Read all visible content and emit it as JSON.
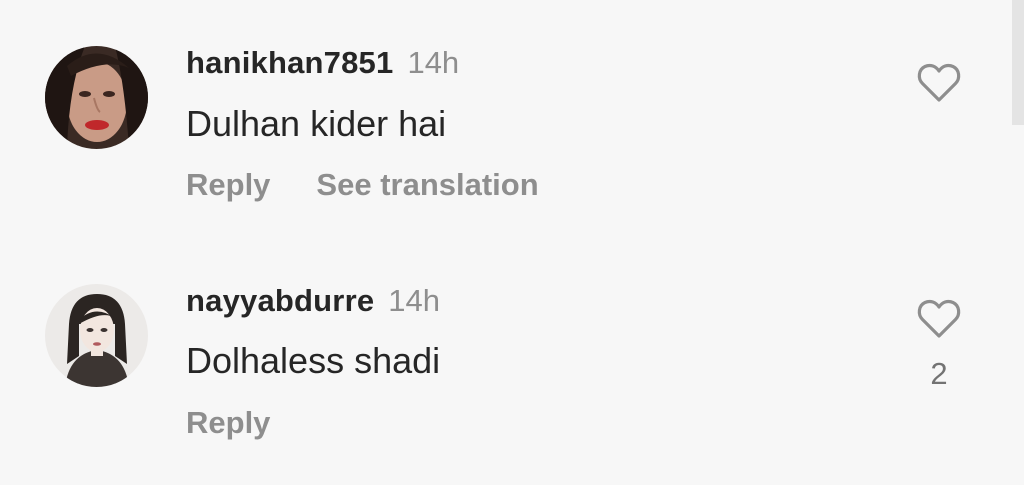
{
  "comments": [
    {
      "username": "hanikhan7851",
      "time": "14h",
      "text": "Dulhan kider hai",
      "reply_label": "Reply",
      "translate_label": "See translation",
      "like_count": ""
    },
    {
      "username": "nayyabdurre",
      "time": "14h",
      "text": "Dolhaless shadi",
      "reply_label": "Reply",
      "like_count": "2"
    }
  ],
  "icons": {
    "like": "heart-outline-icon"
  },
  "colors": {
    "background": "#f7f7f7",
    "primary_text": "#262626",
    "secondary_text": "#8e8e8e",
    "heart_stroke": "#8e8e8e"
  }
}
